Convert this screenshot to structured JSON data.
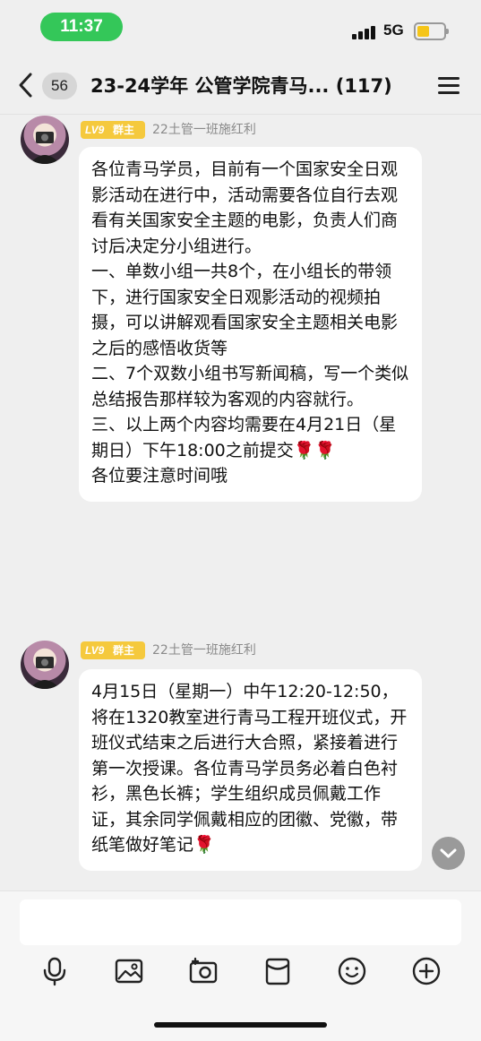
{
  "status_bar": {
    "time": "11:37",
    "network": "5G",
    "battery_level": 0.35,
    "accent_color": "#34c759"
  },
  "nav": {
    "back_icon": "chevron-left-icon",
    "unread_count": "56",
    "title": "23-24学年 公管学院青马... (117)",
    "menu_icon": "hamburger-menu-icon"
  },
  "messages": [
    {
      "level": "LV9",
      "role": "群主",
      "sender": "22土管一班施红利",
      "text": "各位青马学员，目前有一个国家安全日观影活动在进行中，活动需要各位自行去观看有关国家安全主题的电影，负责人们商讨后决定分小组进行。\n一、单数小组一共8个，在小组长的带领下，进行国家安全日观影活动的视频拍摄，可以讲解观看国家安全主题相关电影之后的感悟收货等\n二、7个双数小组书写新闻稿，写一个类似总结报告那样较为客观的内容就行。\n三、以上两个内容均需要在4月21日（星期日）下午18:00之前提交🌹🌹\n各位要注意时间哦"
    },
    {
      "level": "LV9",
      "role": "群主",
      "sender": "22土管一班施红利",
      "text": "4月15日（星期一）中午12:20-12:50，将在1320教室进行青马工程开班仪式，开班仪式结束之后进行大合照，紧接着进行第一次授课。各位青马学员务必着白色衬衫，黑色长裤；学生组织成员佩戴工作证，其余同学佩戴相应的团徽、党徽，带纸笔做好笔记🌹"
    }
  ],
  "input": {
    "placeholder": "",
    "value": ""
  },
  "toolbar": {
    "icons": [
      "microphone-icon",
      "image-icon",
      "camera-icon",
      "red-packet-icon",
      "emoji-icon",
      "plus-icon"
    ]
  }
}
